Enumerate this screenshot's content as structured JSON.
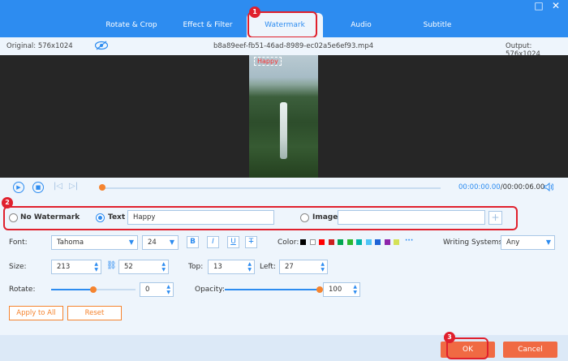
{
  "tabs": [
    {
      "label": "Rotate & Crop"
    },
    {
      "label": "Effect & Filter"
    },
    {
      "label": "Watermark"
    },
    {
      "label": "Audio"
    },
    {
      "label": "Subtitle"
    }
  ],
  "window": {
    "minimize": "□",
    "close": "✕"
  },
  "info": {
    "original": "Original: 576x1024",
    "filename": "b8a89eef-fb51-46ad-8989-ec02a5e6ef93.mp4",
    "output": "Output: 576x1024"
  },
  "preview": {
    "watermark_text": "Happy"
  },
  "playback": {
    "progress": 0.0,
    "current_time": "00:00:00.00",
    "total_time": "/00:00:06.00"
  },
  "watermark": {
    "no_watermark_label": "No Watermark",
    "text_label": "Text",
    "text_value": "Happy",
    "image_label": "Image",
    "image_value": "",
    "add_image": "+",
    "selected": "Text"
  },
  "style": {
    "font_label": "Font:",
    "font_value": "Tahoma",
    "font_size": "24",
    "bold": "B",
    "italic": "I",
    "underline": "U",
    "strike": "T",
    "color_label": "Color:",
    "colors": [
      "#000000",
      "#ffffff",
      "#ff0000",
      "#cc1f1f",
      "#00a650",
      "#2eb82e",
      "#00b3a6",
      "#4fc3f7",
      "#1e63d6",
      "#8e24aa",
      "#d4e157"
    ],
    "more_colors": "···",
    "writing_label": "Writing Systems:",
    "writing_value": "Any"
  },
  "size": {
    "label": "Size:",
    "width": "213",
    "height": "52",
    "top_label": "Top:",
    "top": "13",
    "left_label": "Left:",
    "left": "27"
  },
  "transform": {
    "rotate_label": "Rotate:",
    "rotate_value": "0",
    "rotate_fraction": 0.5,
    "opacity_label": "Opacity:",
    "opacity_value": "100",
    "opacity_fraction": 1.0
  },
  "actions": {
    "apply_all": "Apply to All",
    "reset": "Reset",
    "ok": "OK",
    "cancel": "Cancel"
  },
  "annotations": [
    "1",
    "2",
    "3"
  ]
}
